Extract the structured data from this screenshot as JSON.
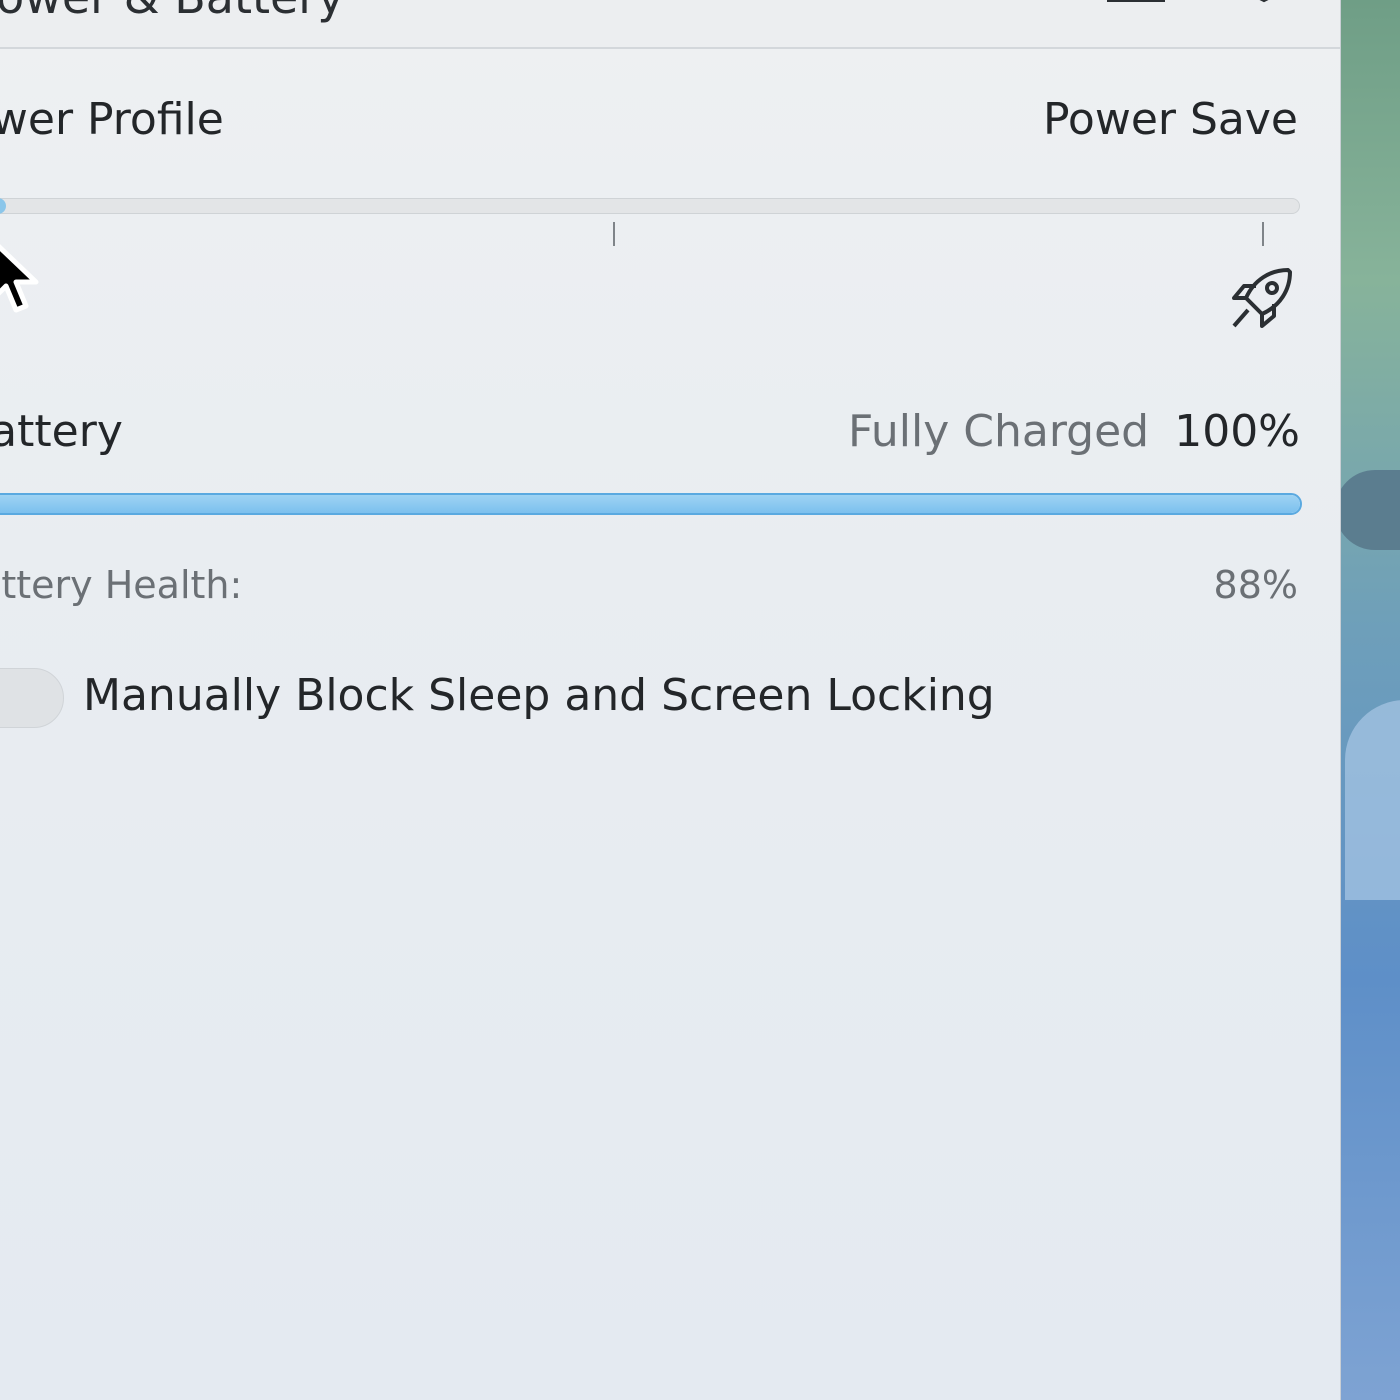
{
  "window": {
    "title": "Power & Battery"
  },
  "power_profile": {
    "label": "Power Profile",
    "current_value": "Power Save",
    "slider_position": 0,
    "slider_steps": 3,
    "performance_icon": "rocket-icon"
  },
  "battery": {
    "label": "Battery",
    "status": "Fully Charged",
    "percent_text": "100%",
    "charge_level": 100,
    "health_label": "Battery Health:",
    "health_value": "88%"
  },
  "inhibit": {
    "label": "Manually Block Sleep and Screen Locking",
    "enabled": false
  },
  "colors": {
    "accent": "#5aa9e0",
    "panel_bg": "#eceef0",
    "text": "#232629",
    "muted_text": "#6b7075"
  }
}
